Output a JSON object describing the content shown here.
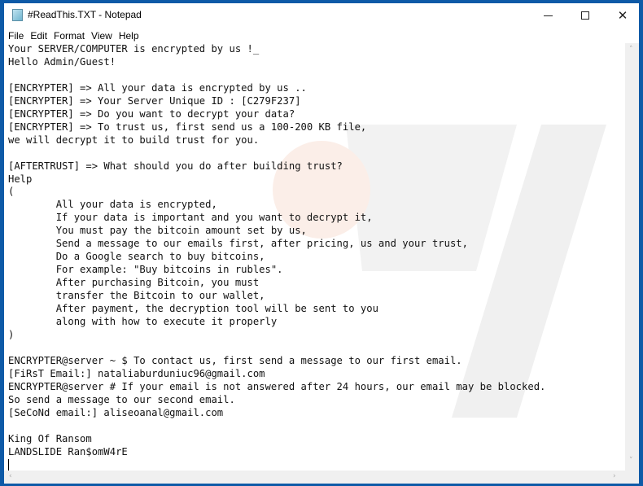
{
  "window": {
    "title": "#ReadThis.TXT - Notepad",
    "controls": {
      "minimize": "minimize",
      "maximize": "maximize",
      "close": "✕"
    }
  },
  "menu": [
    "File",
    "Edit",
    "Format",
    "View",
    "Help"
  ],
  "document": {
    "lines": [
      "Your SERVER/COMPUTER is encrypted by us !_",
      "Hello Admin/Guest!",
      "",
      "[ENCRYPTER] => All your data is encrypted by us ..",
      "[ENCRYPTER] => Your Server Unique ID : [C279F237]",
      "[ENCRYPTER] => Do you want to decrypt your data?",
      "[ENCRYPTER] => To trust us, first send us a 100-200 KB file,",
      "we will decrypt it to build trust for you.",
      "",
      "[AFTERTRUST] => What should you do after building trust?",
      "Help",
      "(",
      "        All your data is encrypted,",
      "        If your data is important and you want to decrypt it,",
      "        You must pay the bitcoin amount set by us,",
      "        Send a message to our emails first, after pricing, us and your trust,",
      "        Do a Google search to buy bitcoins,",
      "        For example: \"Buy bitcoins in rubles\".",
      "        After purchasing Bitcoin, you must",
      "        transfer the Bitcoin to our wallet,",
      "        After payment, the decryption tool will be sent to you",
      "        along with how to execute it properly",
      ")",
      "",
      "ENCRYPTER@server ~ $ To contact us, first send a message to our first email.",
      "[FiRsT Email:] nataliaburduniuc96@gmail.com",
      "ENCRYPTER@server # If your email is not answered after 24 hours, our email may be blocked.",
      "So send a message to our second email.",
      "[SeCoNd email:] aliseoanal@gmail.com",
      "",
      "King Of Ransom",
      "LANDSLIDE Ran$omW4rE"
    ]
  },
  "scrollbars": {
    "up": "˄",
    "down": "˅",
    "left": "‹",
    "right": "›"
  },
  "colors": {
    "frame": "#0e5aa7",
    "background": "#ffffff",
    "text": "#111111"
  }
}
